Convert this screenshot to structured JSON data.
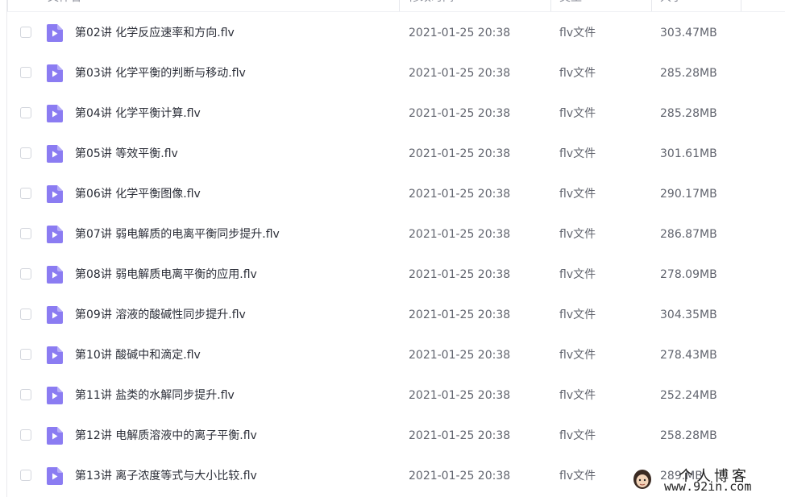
{
  "header": {
    "name": "文件名",
    "modified": "修改时间",
    "type": "类型",
    "size": "大小"
  },
  "files": [
    {
      "name": "第02讲 化学反应速率和方向.flv",
      "time": "2021-01-25 20:38",
      "type": "flv文件",
      "size": "303.47MB"
    },
    {
      "name": "第03讲 化学平衡的判断与移动.flv",
      "time": "2021-01-25 20:38",
      "type": "flv文件",
      "size": "285.28MB"
    },
    {
      "name": "第04讲 化学平衡计算.flv",
      "time": "2021-01-25 20:38",
      "type": "flv文件",
      "size": "285.28MB"
    },
    {
      "name": "第05讲 等效平衡.flv",
      "time": "2021-01-25 20:38",
      "type": "flv文件",
      "size": "301.61MB"
    },
    {
      "name": "第06讲 化学平衡图像.flv",
      "time": "2021-01-25 20:38",
      "type": "flv文件",
      "size": "290.17MB"
    },
    {
      "name": "第07讲 弱电解质的电离平衡同步提升.flv",
      "time": "2021-01-25 20:38",
      "type": "flv文件",
      "size": "286.87MB"
    },
    {
      "name": "第08讲 弱电解质电离平衡的应用.flv",
      "time": "2021-01-25 20:38",
      "type": "flv文件",
      "size": "278.09MB"
    },
    {
      "name": "第09讲 溶液的酸碱性同步提升.flv",
      "time": "2021-01-25 20:38",
      "type": "flv文件",
      "size": "304.35MB"
    },
    {
      "name": "第10讲 酸碱中和滴定.flv",
      "time": "2021-01-25 20:38",
      "type": "flv文件",
      "size": "278.43MB"
    },
    {
      "name": "第11讲 盐类的水解同步提升.flv",
      "time": "2021-01-25 20:38",
      "type": "flv文件",
      "size": "252.24MB"
    },
    {
      "name": "第12讲 电解质溶液中的离子平衡.flv",
      "time": "2021-01-25 20:38",
      "type": "flv文件",
      "size": "258.28MB"
    },
    {
      "name": "第13讲 离子浓度等式与大小比较.flv",
      "time": "2021-01-25 20:38",
      "type": "flv文件",
      "size": "289.MB"
    }
  ],
  "icons": {
    "file": "video-file-icon",
    "sort": "sort-arrow-icon"
  },
  "colors": {
    "file_icon": "#8b7cf2",
    "file_icon_fold": "#b6acf8"
  },
  "watermark": {
    "title": "个人博客",
    "url": "www.92in.com"
  }
}
